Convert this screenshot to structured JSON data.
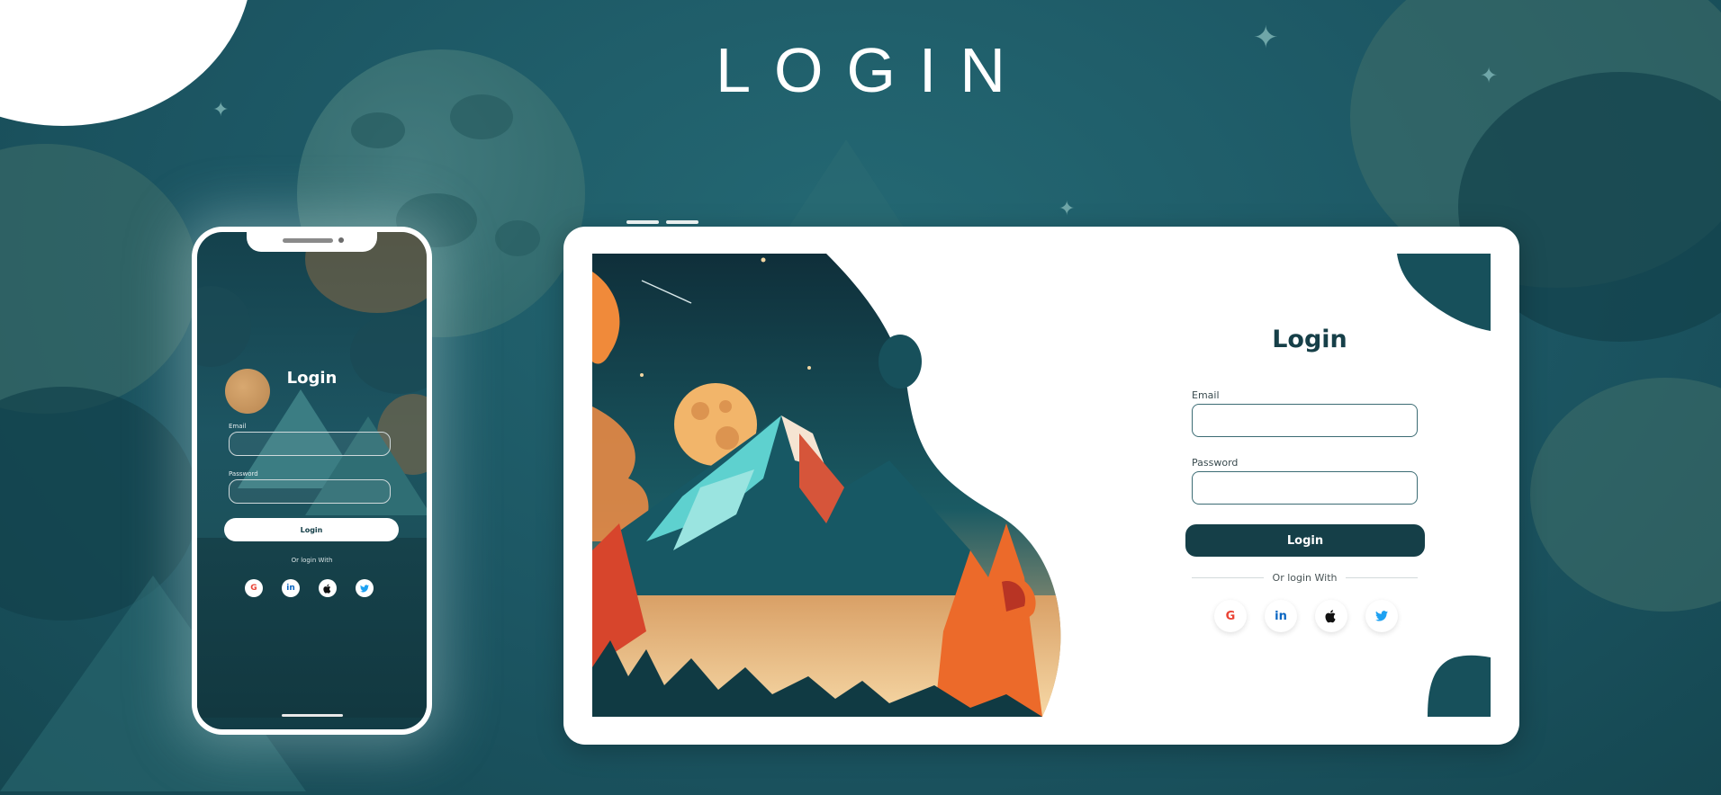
{
  "page": {
    "title": "LOGIN"
  },
  "phone": {
    "title": "Login",
    "email_label": "Email",
    "password_label": "Password",
    "login_label": "Login",
    "or_text": "Or login With",
    "social": [
      {
        "name": "google",
        "glyph": "G",
        "color": "#ea4335"
      },
      {
        "name": "linkedin",
        "glyph": "in",
        "color": "#0a66c2"
      },
      {
        "name": "apple",
        "glyph": "",
        "color": "#111111"
      },
      {
        "name": "twitter",
        "glyph": "t",
        "color": "#1da1f2"
      }
    ]
  },
  "tablet": {
    "title": "Login",
    "email_label": "Email",
    "email_value": "",
    "password_label": "Password",
    "password_value": "",
    "login_label": "Login",
    "or_text": "Or login With",
    "social": [
      {
        "name": "google",
        "glyph": "G",
        "color": "#ea4335"
      },
      {
        "name": "linkedin",
        "glyph": "in",
        "color": "#0a66c2"
      },
      {
        "name": "apple",
        "glyph": "",
        "color": "#111111"
      },
      {
        "name": "twitter",
        "glyph": "t",
        "color": "#1da1f2"
      }
    ]
  },
  "colors": {
    "brand_dark": "#153f48",
    "background_teal": "#1d5a66",
    "accent_orange": "#f08a3a"
  }
}
